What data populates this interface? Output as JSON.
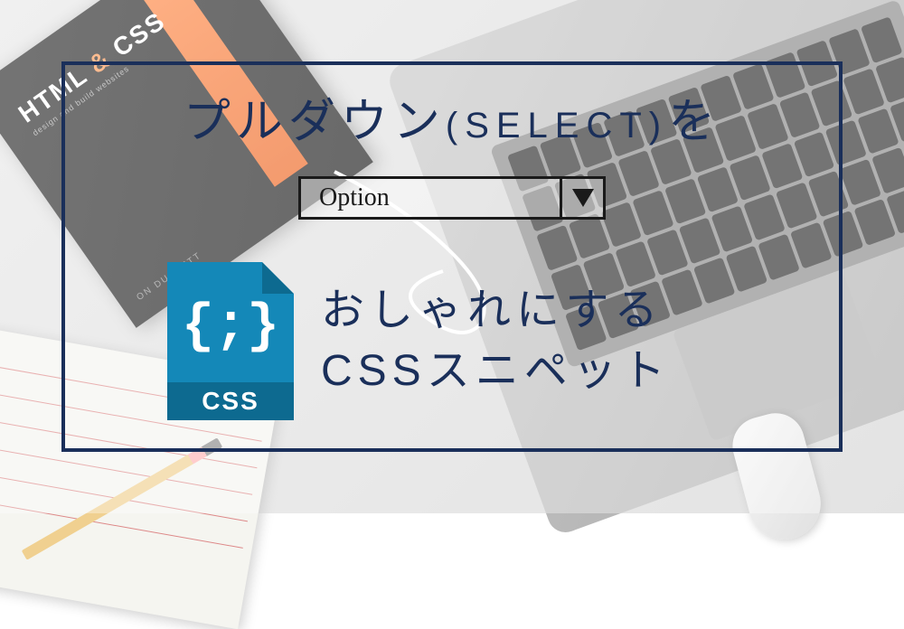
{
  "book": {
    "title_html": "HTML",
    "title_amp": "&",
    "title_css": "CSS",
    "subtitle": "design and build websites",
    "author": "ON DUCKETT"
  },
  "title": {
    "main": "プルダウン",
    "select": "(SELECT)",
    "suffix": "を"
  },
  "select_mockup": {
    "option_text": "Option"
  },
  "css_icon": {
    "braces": "{;}",
    "label": "CSS"
  },
  "bottom": {
    "line1": "おしゃれにする",
    "line2": "CSSスニペット"
  }
}
